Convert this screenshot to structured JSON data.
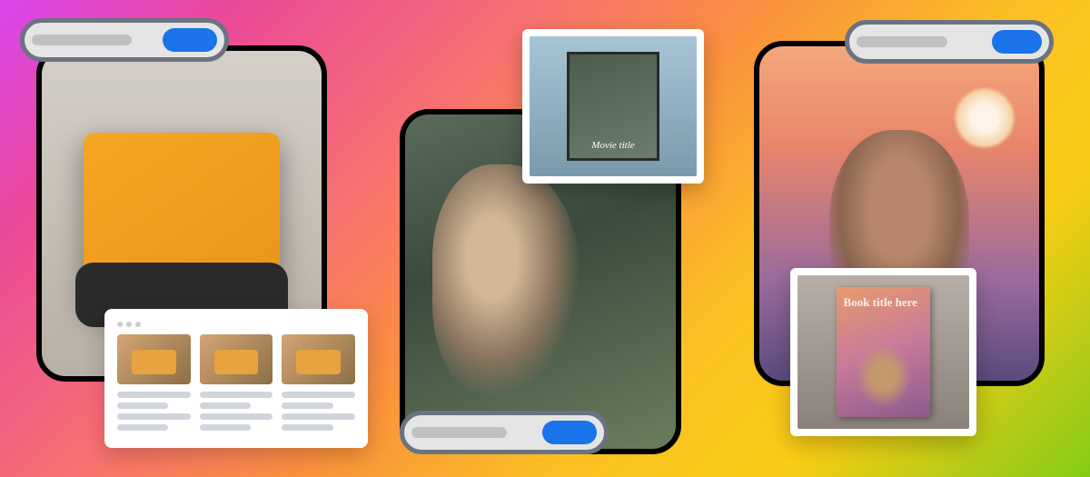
{
  "cards": {
    "bulldozer": {
      "subject": "toy-bulldozer",
      "grid_thumbs": [
        "bulldozer-1",
        "bulldozer-2",
        "bulldozer-3"
      ]
    },
    "face": {
      "subject": "nature-face-portrait",
      "overlay": {
        "type": "poster-mockup",
        "text": "Movie title"
      }
    },
    "deer": {
      "subject": "cartoon-deer-sunset",
      "overlay": {
        "type": "book-mockup",
        "title": "Book title here"
      }
    }
  },
  "colors": {
    "accent": "#1a73e8",
    "pill_border": "#6b7280",
    "pill_bg": "#e5e5e5"
  }
}
